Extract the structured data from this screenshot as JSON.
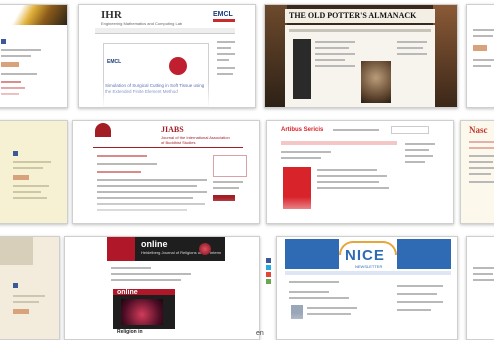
{
  "tiles": {
    "ihr": {
      "logo": "IHR",
      "subtitle": "Engineering Mathematics and Computing Lab",
      "emcl": "EMCL",
      "slide_title": "Simulation of Surgical Cutting in Soft Tissue using the Extended Finite Element Method",
      "slide_logo": "EMCL"
    },
    "potter": {
      "title": "THE OLD POTTER'S ALMANACK"
    },
    "jiabs": {
      "title": "JIABS",
      "subtitle": "Journal of the International Association of Buddhist Studies"
    },
    "artibus": {
      "title": "Artibus Sericis"
    },
    "mase": {
      "title": "Nasc"
    },
    "online": {
      "header": "online",
      "header_sub": "Heidelberg Journal of Religions on the Internet",
      "inner": "online",
      "caption": "Religion in"
    },
    "nice": {
      "title": "NICE",
      "subtitle": "NEWSLETTER"
    },
    "caption_fragment": "en"
  },
  "colors": {
    "potter_bg": "#3a2a1e",
    "online_red": "#b0182a",
    "online_dark": "#1e1e1e",
    "nice_blue": "#2f6bb5",
    "nice_orange": "#e6a73a",
    "artibus_red": "#d8232a",
    "jiabs_red": "#a31d24",
    "mase_red": "#c0392b"
  },
  "icons": [
    "facebook-icon",
    "share-icon",
    "plus-icon",
    "email-icon"
  ]
}
